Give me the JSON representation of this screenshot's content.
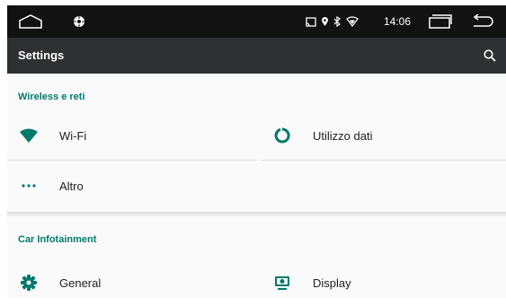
{
  "statusbar": {
    "time": "14:06",
    "icons": [
      "home-icon",
      "settings-shortcut-icon",
      "cast-icon",
      "location-icon",
      "bluetooth-icon",
      "wifi-signal-icon",
      "recents-icon",
      "back-icon"
    ]
  },
  "toolbar": {
    "title": "Settings",
    "search_icon": "search-icon"
  },
  "sections": [
    {
      "header": "Wireless e reti",
      "items": [
        {
          "label": "Wi-Fi",
          "icon": "wifi-icon"
        },
        {
          "label": "Utilizzo dati",
          "icon": "data-usage-icon"
        },
        {
          "label": "Altro",
          "icon": "more-icon"
        }
      ]
    },
    {
      "header": "Car Infotainment",
      "items": [
        {
          "label": "General",
          "icon": "gear-icon"
        },
        {
          "label": "Display",
          "icon": "display-icon"
        }
      ]
    }
  ],
  "colors": {
    "accent": "#00796b",
    "statusbar_bg": "#121212",
    "toolbar_bg": "#2d3133",
    "background": "#fafafa"
  }
}
